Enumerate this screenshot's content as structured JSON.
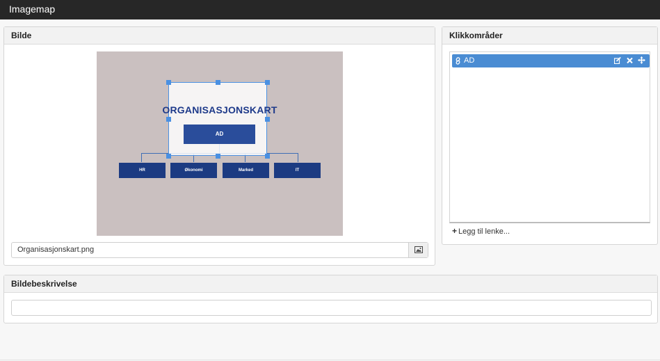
{
  "app": {
    "title": "Imagemap"
  },
  "bilde": {
    "heading": "Bilde",
    "image": {
      "title": "ORGANISASJONSKART",
      "top_box": "AD",
      "departments": [
        "HR",
        "Økonomi",
        "Marked",
        "IT"
      ]
    },
    "file_name": "Organisasjonskart.png"
  },
  "klikk": {
    "heading": "Klikkområder",
    "areas": [
      {
        "label": "AD"
      }
    ],
    "add_label": "Legg til lenke..."
  },
  "beskrivelse": {
    "heading": "Bildebeskrivelse",
    "value": ""
  },
  "colors": {
    "accent": "#4a8cd3",
    "topbar": "#272727",
    "hotspot": "#4a90e2"
  }
}
